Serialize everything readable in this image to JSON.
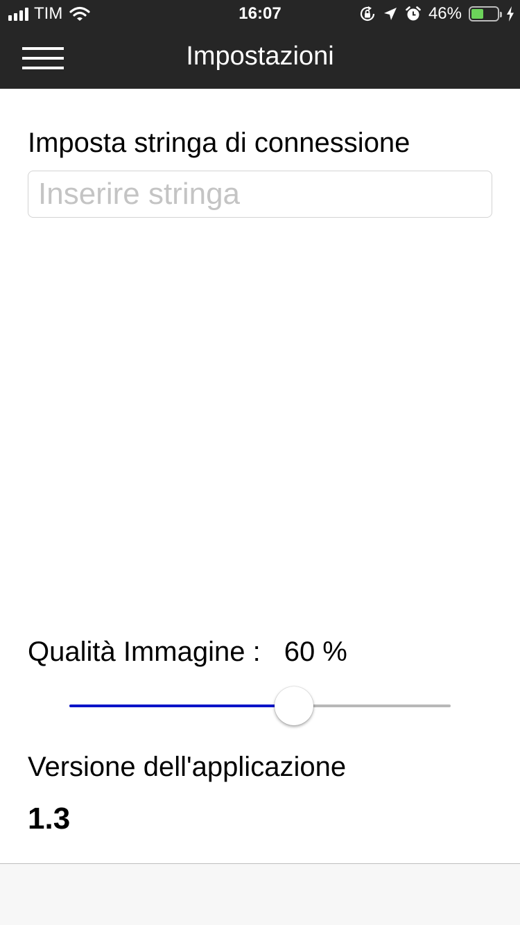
{
  "status_bar": {
    "carrier": "TIM",
    "time": "16:07",
    "battery_percent": "46%",
    "battery_level": 0.46,
    "icons": [
      "signal-icon",
      "wifi-icon",
      "orientation-lock-icon",
      "location-arrow-icon",
      "alarm-icon",
      "battery-icon",
      "charging-bolt-icon"
    ]
  },
  "navbar": {
    "title": "Impostazioni",
    "menu_icon": "hamburger-menu-icon"
  },
  "connection": {
    "label": "Imposta stringa di connessione",
    "value": "",
    "placeholder": "Inserire stringa"
  },
  "quality": {
    "label": "Qualità Immagine :",
    "value_text": "60 %",
    "value": 60,
    "min": 0,
    "max": 100
  },
  "version": {
    "label": "Versione dell'applicazione",
    "value": "1.3"
  },
  "colors": {
    "header_bg": "#262626",
    "slider_fill": "#0a14c8",
    "slider_track": "#b8b8b8",
    "battery_fill": "#6cd35a"
  }
}
